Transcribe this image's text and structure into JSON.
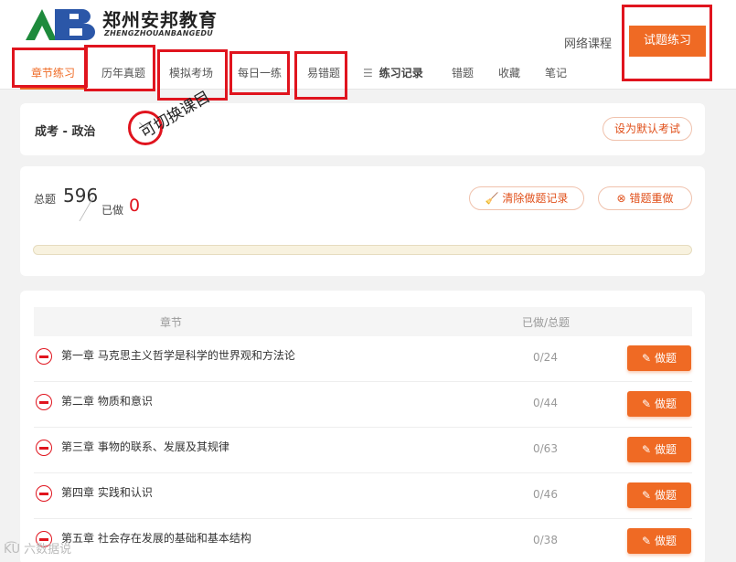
{
  "brand": {
    "name": "郑州安邦教育",
    "name_en": "ZHENGZHOUANBANGEDU",
    "logo_letters": "AB"
  },
  "top_nav": {
    "course": "网络课程",
    "practice": "试题练习"
  },
  "tabs": [
    "章节练习",
    "历年真题",
    "模拟考场",
    "每日一练",
    "易错题",
    "练习记录",
    "错题",
    "收藏",
    "笔记"
  ],
  "subject": {
    "label": "成考 - 政治",
    "annotation": "可切换课目",
    "default_button": "设为默认考试"
  },
  "stats": {
    "total_label": "总题",
    "total": "596",
    "done_label": "已做",
    "done": "0",
    "clear_button": "清除做题记录",
    "redo_button": "错题重做",
    "progress": 0
  },
  "table": {
    "col_chapter": "章节",
    "col_progress": "已做/总题",
    "do_label": "做题",
    "rows": [
      {
        "title": "第一章 马克思主义哲学是科学的世界观和方法论",
        "count": "0/24"
      },
      {
        "title": "第二章 物质和意识",
        "count": "0/44"
      },
      {
        "title": "第三章 事物的联系、发展及其规律",
        "count": "0/63"
      },
      {
        "title": "第四章 实践和认识",
        "count": "0/46"
      },
      {
        "title": "第五章 社会存在发展的基础和基本结构",
        "count": "0/38"
      }
    ]
  },
  "watermark": "K͡U 六数据说",
  "colors": {
    "accent": "#ef6a24",
    "annotation_red": "#e0141e",
    "logo_green": "#1e8a3c",
    "logo_blue": "#2b57a8"
  }
}
